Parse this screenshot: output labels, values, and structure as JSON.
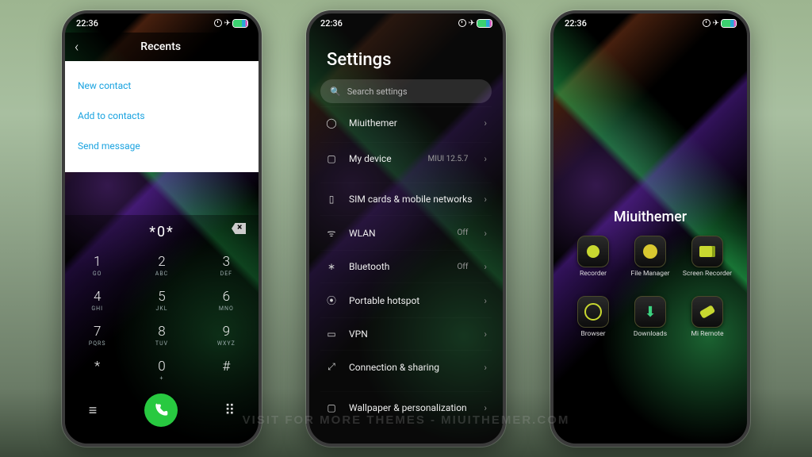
{
  "status": {
    "time": "22:36",
    "battery_icon": "batt"
  },
  "watermark": "VISIT FOR MORE THEMES - MIUITHEMER.COM",
  "phone1": {
    "header_title": "Recents",
    "menu": {
      "new_contact": "New contact",
      "add_to_contacts": "Add to contacts",
      "send_message": "Send message"
    },
    "dial_input": "*0*",
    "keys": [
      {
        "n": "1",
        "l": "GO"
      },
      {
        "n": "2",
        "l": "ABC"
      },
      {
        "n": "3",
        "l": "DEF"
      },
      {
        "n": "4",
        "l": "GHI"
      },
      {
        "n": "5",
        "l": "JKL"
      },
      {
        "n": "6",
        "l": "MNO"
      },
      {
        "n": "7",
        "l": "PQRS"
      },
      {
        "n": "8",
        "l": "TUV"
      },
      {
        "n": "9",
        "l": "WXYZ"
      },
      {
        "n": "*",
        "l": ""
      },
      {
        "n": "0",
        "l": "+"
      },
      {
        "n": "#",
        "l": ""
      }
    ]
  },
  "phone2": {
    "title": "Settings",
    "search_placeholder": "Search settings",
    "account_label": "Miuithemer",
    "rows": [
      {
        "icon": "▢",
        "label": "My device",
        "value": "MIUI 12.5.7"
      },
      {
        "icon": "▯",
        "label": "SIM cards & mobile networks",
        "value": ""
      },
      {
        "icon": "ᯤ",
        "label": "WLAN",
        "value": "Off"
      },
      {
        "icon": "∗",
        "label": "Bluetooth",
        "value": "Off"
      },
      {
        "icon": "⦿",
        "label": "Portable hotspot",
        "value": ""
      },
      {
        "icon": "▭",
        "label": "VPN",
        "value": ""
      },
      {
        "icon": "⤢",
        "label": "Connection & sharing",
        "value": ""
      },
      {
        "icon": "▢",
        "label": "Wallpaper & personalization",
        "value": ""
      }
    ]
  },
  "phone3": {
    "folder_title": "Miuithemer",
    "apps": [
      {
        "label": "Recorder",
        "k": "rec"
      },
      {
        "label": "File Manager",
        "k": "fm"
      },
      {
        "label": "Screen Recorder",
        "k": "scr"
      },
      {
        "label": "Browser",
        "k": "br"
      },
      {
        "label": "Downloads",
        "k": "dl"
      },
      {
        "label": "Mi Remote",
        "k": "rem"
      }
    ]
  }
}
